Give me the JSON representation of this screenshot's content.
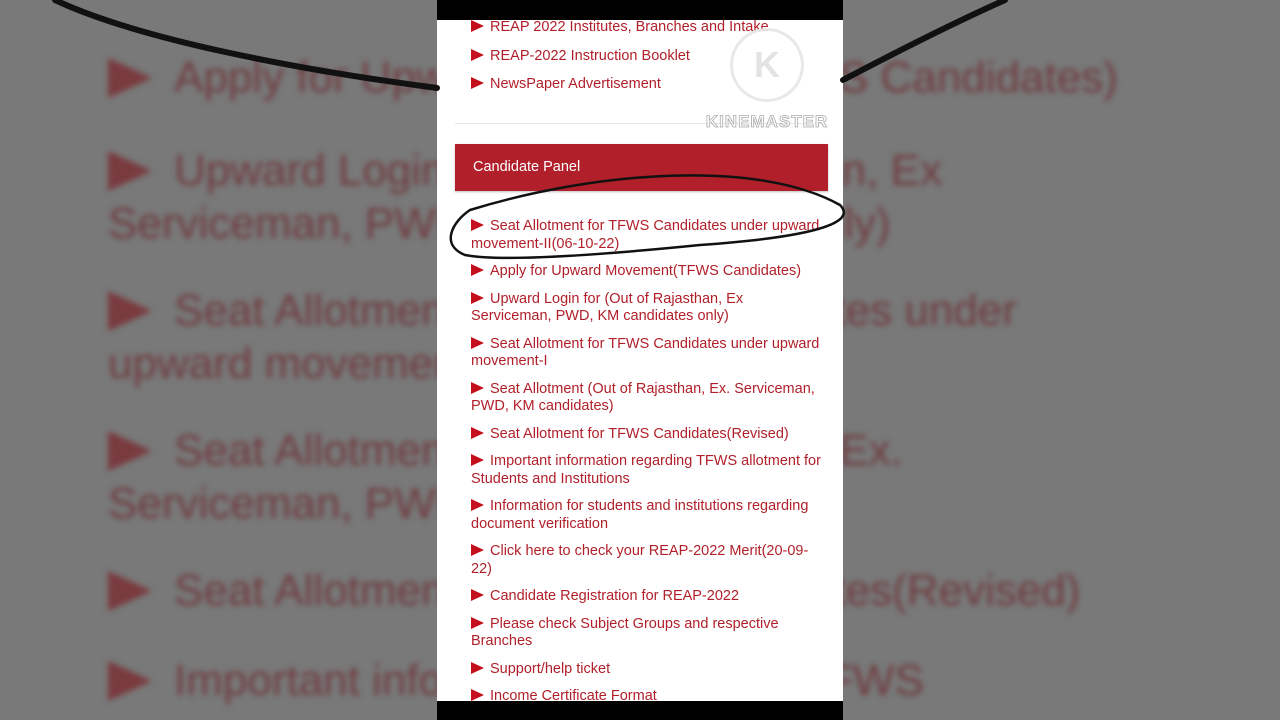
{
  "background_lines": [
    {
      "text": "Apply for Upward Movement(TFWS Candidates)"
    },
    {
      "text": "Upward Login for (Out of Rajasthan, Ex"
    },
    {
      "text": "Serviceman, PWD, KM candidates only)"
    },
    {
      "text": "Seat Allotment for TFWS Candidates under"
    },
    {
      "text": "upward movement-I"
    },
    {
      "text": "Seat Allotment (Out of Rajasthan, Ex."
    },
    {
      "text": "Serviceman, PWD, KM candidates)"
    },
    {
      "text": "Seat Allotment for TFWS Candidates(Revised)"
    },
    {
      "text": "Important information regarding TFWS"
    }
  ],
  "top_links": [
    "REAP 2022 Institutes, Branches and Intake",
    "REAP-2022 Instruction Booklet",
    "NewsPaper Advertisement"
  ],
  "watermark": {
    "letter": "K",
    "text": "KINEMASTER"
  },
  "panel": {
    "title": "Candidate Panel",
    "links": [
      "Seat Allotment for TFWS Candidates under upward movement-II(06-10-22)",
      "Apply for Upward Movement(TFWS Candidates)",
      "Upward Login for (Out of Rajasthan, Ex Serviceman, PWD, KM candidates only)",
      "Seat Allotment for TFWS Candidates under upward movement-I",
      "Seat Allotment (Out of Rajasthan, Ex. Serviceman, PWD, KM candidates)",
      "Seat Allotment for TFWS Candidates(Revised)",
      "Important information regarding TFWS allotment for Students and Institutions",
      "Information for students and institutions regarding document verification",
      "Click here to check your REAP-2022 Merit(20-09-22)",
      "Candidate Registration for REAP-2022",
      "Please check Subject Groups and respective Branches",
      "Support/help ticket",
      "Income Certificate Format"
    ]
  },
  "colors": {
    "brand_red": "#b1202a",
    "triangle_red": "#c4101c",
    "background": "#ffffff"
  }
}
